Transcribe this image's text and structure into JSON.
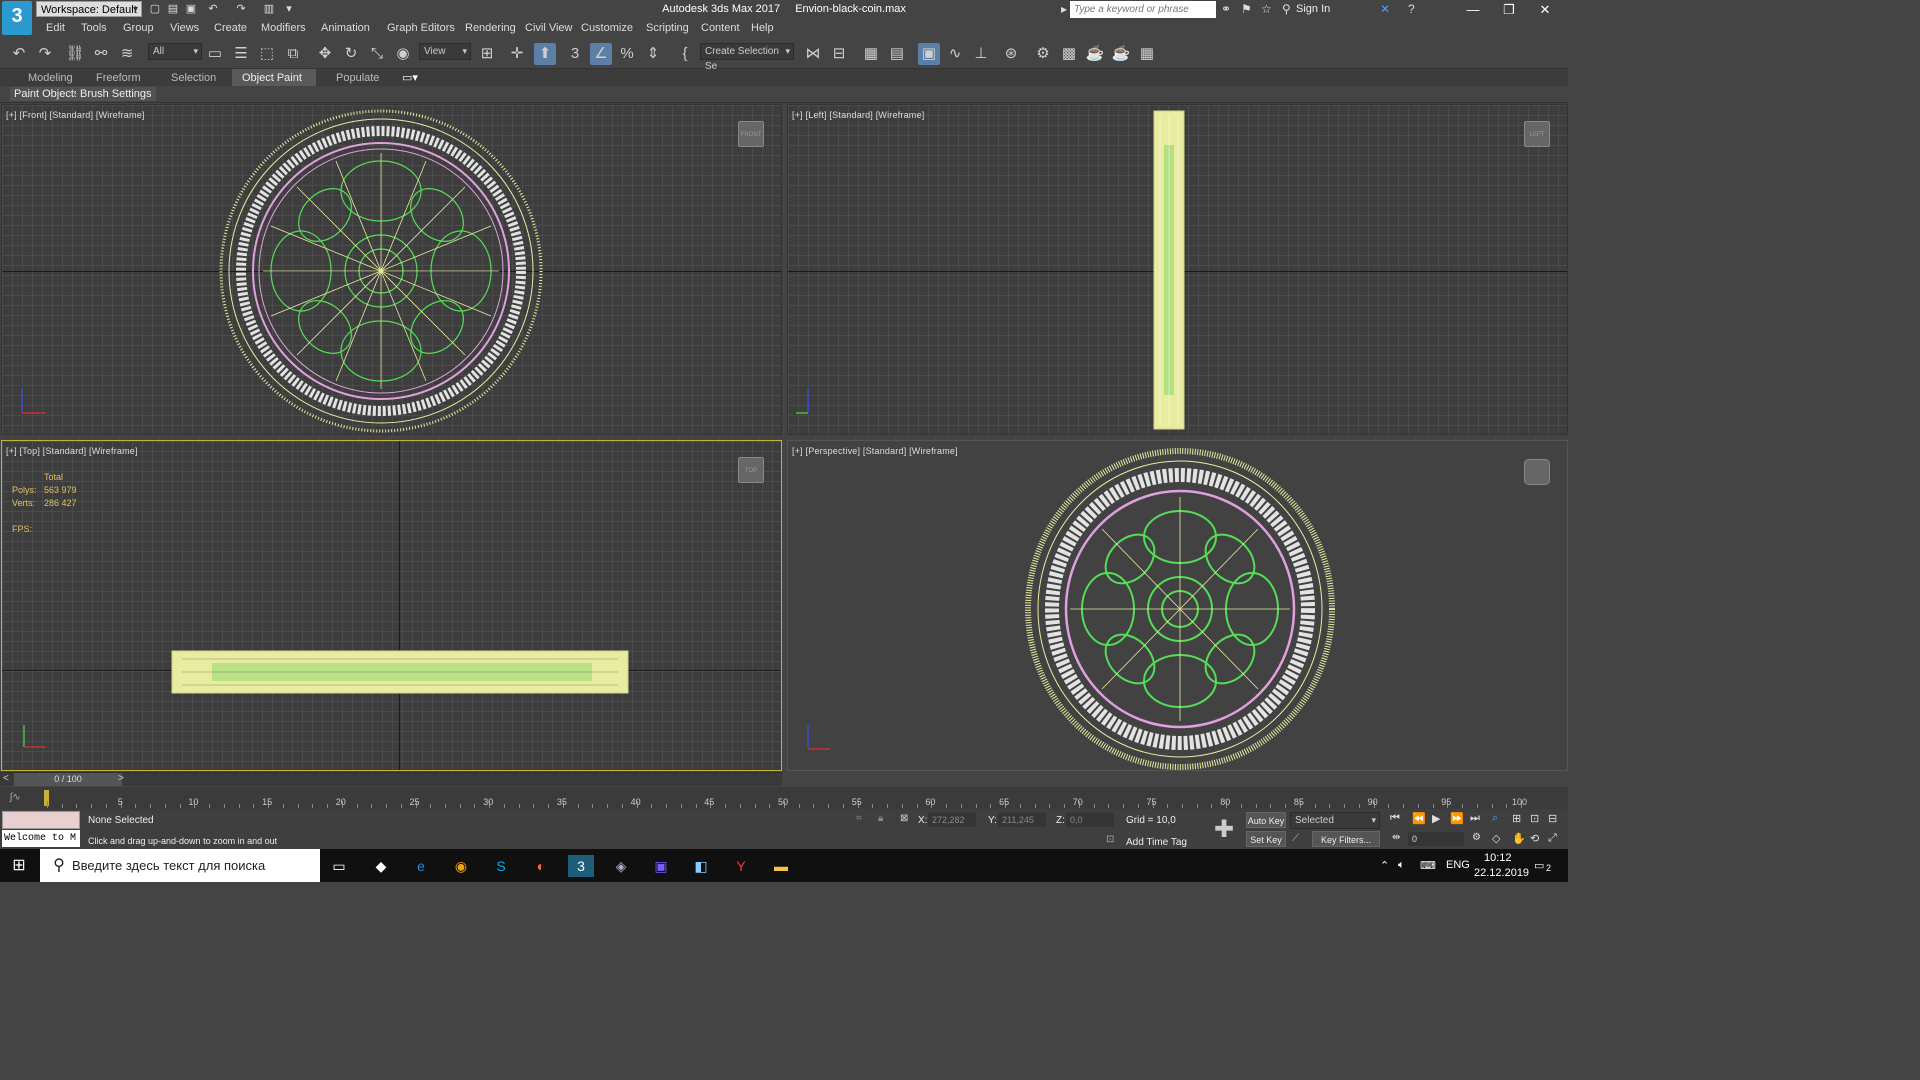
{
  "window": {
    "workspace_label": "Workspace: Default",
    "app_title": "Autodesk 3ds Max 2017",
    "file_name": "Envion-black-coin.max",
    "search_placeholder": "Type a keyword or phrase",
    "sign_in": "Sign In",
    "logo": "3"
  },
  "menu": [
    "Edit",
    "Tools",
    "Group",
    "Views",
    "Create",
    "Modifiers",
    "Animation",
    "Graph Editors",
    "Rendering",
    "Civil View",
    "Customize",
    "Scripting",
    "Content",
    "Help"
  ],
  "toolbar": {
    "filter_value": "All",
    "refcoord_value": "View",
    "selection_set_value": "Create Selection Se"
  },
  "ribbon": {
    "tabs": [
      "Modeling",
      "Freeform",
      "Selection",
      "Object Paint",
      "Populate"
    ],
    "active_tab": "Object Paint",
    "sub_items": [
      "Paint Objects",
      "Brush Settings"
    ]
  },
  "viewports": {
    "front": {
      "label": "[+] [Front] [Standard] [Wireframe]",
      "cube": "FRONT"
    },
    "left": {
      "label": "[+] [Left] [Standard] [Wireframe]",
      "cube": "LEFT"
    },
    "top": {
      "label": "[+] [Top] [Standard] [Wireframe]",
      "cube": "TOP"
    },
    "perspective": {
      "label": "[+] [Perspective] [Standard] [Wireframe]",
      "cube": ""
    }
  },
  "stats": {
    "header": "Total",
    "polys_label": "Polys:",
    "polys_value": "563 979",
    "verts_label": "Verts:",
    "verts_value": "286 427",
    "fps_label": "FPS:"
  },
  "timeline": {
    "position": "0 / 100",
    "ticks": [
      "0",
      "5",
      "10",
      "15",
      "20",
      "25",
      "30",
      "35",
      "40",
      "45",
      "50",
      "55",
      "60",
      "65",
      "70",
      "75",
      "80",
      "85",
      "90",
      "95",
      "100"
    ]
  },
  "status": {
    "maxscript_text": "Welcome to M",
    "selection": "None Selected",
    "prompt": "Click and drag up-and-down to zoom in and out",
    "x_label": "X:",
    "x_value": "272,282",
    "y_label": "Y:",
    "y_value": "211,245",
    "z_label": "Z:",
    "z_value": "0,0",
    "grid": "Grid = 10,0",
    "add_time_tag": "Add Time Tag",
    "auto_key": "Auto Key",
    "set_key": "Set Key",
    "key_mode": "Selected",
    "key_filters": "Key Filters...",
    "frame": "0"
  },
  "taskbar": {
    "search_placeholder": "Введите здесь текст для поиска",
    "lang": "ENG",
    "time": "10:12",
    "date": "22.12.2019",
    "notifications": "2"
  },
  "colors": {
    "coin_outer": "#e8eca0",
    "coin_ring": "#e0a0e0",
    "coin_inner": "#55dd55",
    "coin_text": "#ffffff",
    "active_border": "#c9b038",
    "accent": "#5b7fa6"
  }
}
